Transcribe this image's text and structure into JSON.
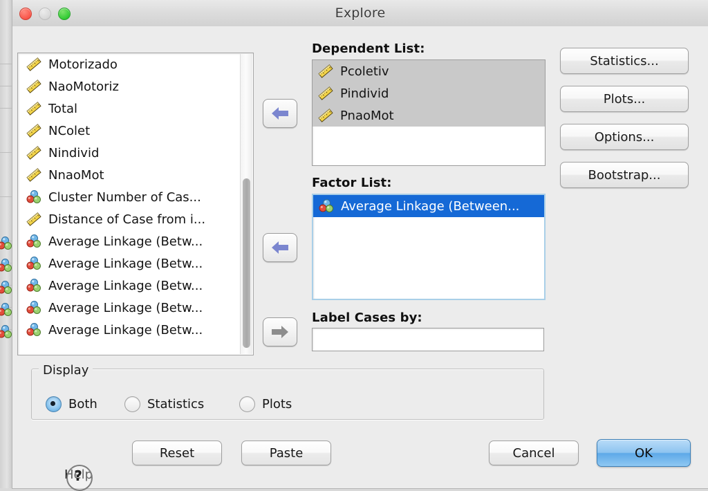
{
  "window": {
    "title": "Explore",
    "traffic_lights": [
      "close-button",
      "minimize-button",
      "zoom-button"
    ]
  },
  "source_list": {
    "name": "source-variable-list",
    "items": [
      {
        "label": "Motorizado",
        "icon": "scale-ruler-icon"
      },
      {
        "label": "NaoMotoriz",
        "icon": "scale-ruler-icon"
      },
      {
        "label": "Total",
        "icon": "scale-ruler-icon"
      },
      {
        "label": "NColet",
        "icon": "scale-ruler-icon"
      },
      {
        "label": "Nindivid",
        "icon": "scale-ruler-icon"
      },
      {
        "label": "NnaoMot",
        "icon": "scale-ruler-icon"
      },
      {
        "label": "Cluster Number of Cas...",
        "icon": "nominal-balls-icon"
      },
      {
        "label": "Distance of Case from i...",
        "icon": "scale-ruler-icon"
      },
      {
        "label": "Average Linkage (Betw...",
        "icon": "nominal-balls-icon"
      },
      {
        "label": "Average Linkage (Betw...",
        "icon": "nominal-balls-icon"
      },
      {
        "label": "Average Linkage (Betw...",
        "icon": "nominal-balls-icon"
      },
      {
        "label": "Average Linkage (Betw...",
        "icon": "nominal-balls-icon"
      },
      {
        "label": "Average Linkage (Betw...",
        "icon": "nominal-balls-icon"
      }
    ]
  },
  "transfer_buttons": [
    {
      "name": "move-to-dependent-list-button",
      "direction": "left",
      "enabled": true
    },
    {
      "name": "move-to-factor-list-button",
      "direction": "left",
      "enabled": true
    },
    {
      "name": "move-to-label-cases-button",
      "direction": "right",
      "enabled": false
    }
  ],
  "dependent_list": {
    "label": "Dependent List:",
    "items": [
      {
        "label": "Pcoletiv",
        "icon": "scale-ruler-icon",
        "selected": true
      },
      {
        "label": "Pindivid",
        "icon": "scale-ruler-icon",
        "selected": true
      },
      {
        "label": "PnaoMot",
        "icon": "scale-ruler-icon",
        "selected": true
      }
    ]
  },
  "factor_list": {
    "label": "Factor List:",
    "items": [
      {
        "label": "Average Linkage (Between...",
        "icon": "nominal-balls-icon",
        "selected": true
      }
    ]
  },
  "label_cases": {
    "label": "Label Cases by:",
    "value": "",
    "placeholder": ""
  },
  "side_buttons": [
    {
      "label": "Statistics...",
      "name": "statistics-button"
    },
    {
      "label": "Plots...",
      "name": "plots-button"
    },
    {
      "label": "Options...",
      "name": "options-button"
    },
    {
      "label": "Bootstrap...",
      "name": "bootstrap-button"
    }
  ],
  "display_group": {
    "title": "Display",
    "options": [
      {
        "label": "Both",
        "selected": true
      },
      {
        "label": "Statistics",
        "selected": false
      },
      {
        "label": "Plots",
        "selected": false
      }
    ]
  },
  "bottom_buttons": {
    "help": "Help",
    "help_cursor_glyph": "?",
    "reset": "Reset",
    "paste": "Paste",
    "cancel": "Cancel",
    "ok": "OK"
  },
  "colors": {
    "dialog_bg": "#ececec",
    "selection_gray": "#c9c9c9",
    "selection_blue": "#1569d6",
    "default_button_blue": "#5ea9e8",
    "focus_border": "#a9cfe8"
  }
}
